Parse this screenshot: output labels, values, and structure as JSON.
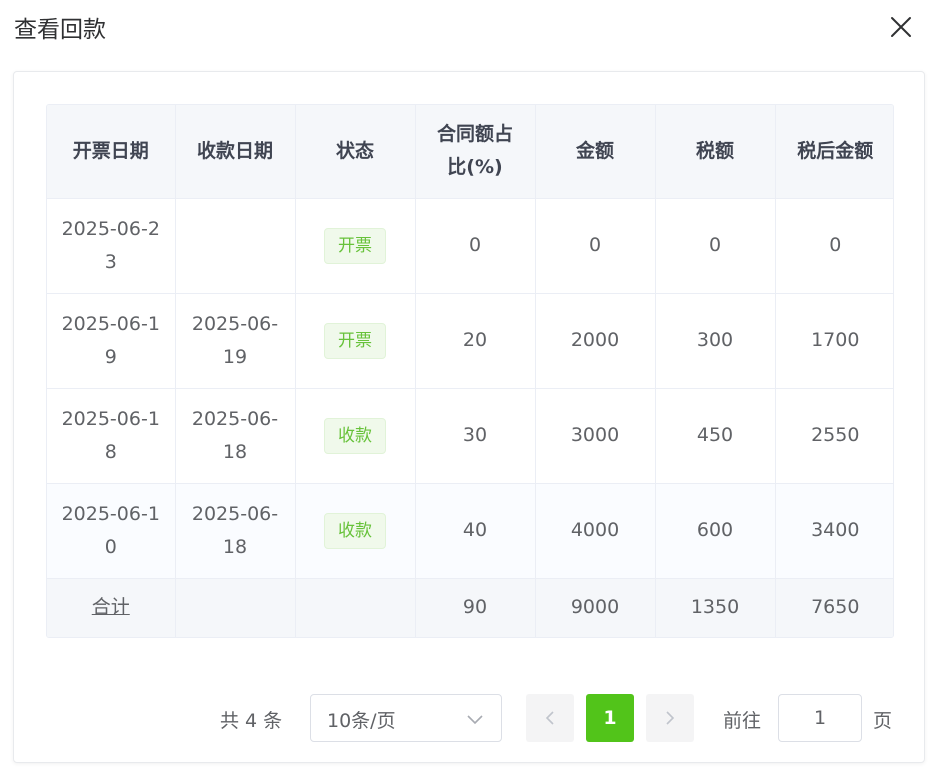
{
  "dialog": {
    "title": "查看回款"
  },
  "table": {
    "columns": [
      "开票日期",
      "收款日期",
      "状态",
      "合同额占比(%)",
      "金额",
      "税额",
      "税后金额"
    ],
    "rows": [
      {
        "invoice_date": "2025-06-23",
        "payment_date": "",
        "status": "开票",
        "ratio": "0",
        "amount": "0",
        "tax": "0",
        "after_tax": "0"
      },
      {
        "invoice_date": "2025-06-19",
        "payment_date": "2025-06-19",
        "status": "开票",
        "ratio": "20",
        "amount": "2000",
        "tax": "300",
        "after_tax": "1700"
      },
      {
        "invoice_date": "2025-06-18",
        "payment_date": "2025-06-18",
        "status": "收款",
        "ratio": "30",
        "amount": "3000",
        "tax": "450",
        "after_tax": "2550"
      },
      {
        "invoice_date": "2025-06-10",
        "payment_date": "2025-06-18",
        "status": "收款",
        "ratio": "40",
        "amount": "4000",
        "tax": "600",
        "after_tax": "3400"
      }
    ],
    "summary": {
      "label": "合计",
      "ratio": "90",
      "amount": "9000",
      "tax": "1350",
      "after_tax": "7650"
    }
  },
  "pagination": {
    "total_text": "共 4 条",
    "page_size": "10条/页",
    "current_page": "1",
    "goto_label": "前往",
    "goto_value": "1",
    "page_unit": "页"
  },
  "colors": {
    "accent": "#52c41a",
    "tag_text": "#67c23a",
    "tag_bg": "#f0f9eb",
    "header_bg": "#f5f7fa"
  },
  "icons": {
    "close": "close-icon",
    "select_arrow": "chevron-down-icon",
    "prev": "chevron-left-icon",
    "next": "chevron-right-icon"
  }
}
